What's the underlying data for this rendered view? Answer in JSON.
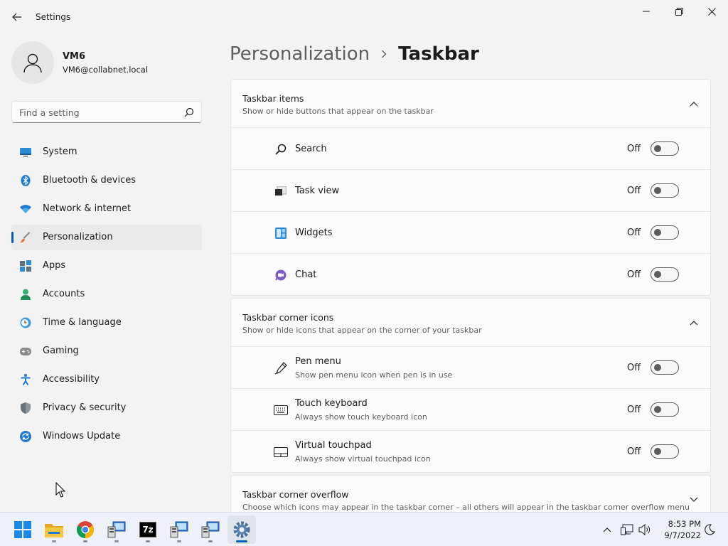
{
  "window": {
    "title": "Settings"
  },
  "user": {
    "name": "VM6",
    "email": "VM6@collabnet.local"
  },
  "search": {
    "placeholder": "Find a setting"
  },
  "nav": [
    {
      "label": "System",
      "icon": "monitor-icon"
    },
    {
      "label": "Bluetooth & devices",
      "icon": "bluetooth-icon"
    },
    {
      "label": "Network & internet",
      "icon": "wifi-icon"
    },
    {
      "label": "Personalization",
      "icon": "brush-icon",
      "active": true
    },
    {
      "label": "Apps",
      "icon": "apps-icon"
    },
    {
      "label": "Accounts",
      "icon": "person-icon"
    },
    {
      "label": "Time & language",
      "icon": "globe-clock-icon"
    },
    {
      "label": "Gaming",
      "icon": "gamepad-icon"
    },
    {
      "label": "Accessibility",
      "icon": "accessibility-icon"
    },
    {
      "label": "Privacy & security",
      "icon": "shield-icon"
    },
    {
      "label": "Windows Update",
      "icon": "update-icon"
    }
  ],
  "breadcrumb": {
    "parent": "Personalization",
    "current": "Taskbar"
  },
  "groups": {
    "taskbar_items": {
      "title": "Taskbar items",
      "description": "Show or hide buttons that appear on the taskbar",
      "rows": [
        {
          "label": "Search",
          "state": "Off",
          "icon": "search-icon"
        },
        {
          "label": "Task view",
          "state": "Off",
          "icon": "task-view-icon"
        },
        {
          "label": "Widgets",
          "state": "Off",
          "icon": "widgets-icon"
        },
        {
          "label": "Chat",
          "state": "Off",
          "icon": "chat-icon"
        }
      ]
    },
    "corner_icons": {
      "title": "Taskbar corner icons",
      "description": "Show or hide icons that appear on the corner of your taskbar",
      "rows": [
        {
          "label": "Pen menu",
          "sub": "Show pen menu icon when pen is in use",
          "state": "Off",
          "icon": "pen-icon"
        },
        {
          "label": "Touch keyboard",
          "sub": "Always show touch keyboard icon",
          "state": "Off",
          "icon": "keyboard-icon"
        },
        {
          "label": "Virtual touchpad",
          "sub": "Always show virtual touchpad icon",
          "state": "Off",
          "icon": "touchpad-icon"
        }
      ]
    },
    "corner_overflow": {
      "title": "Taskbar corner overflow",
      "description": "Choose which icons may appear in the taskbar corner – all others will appear in the taskbar corner overflow menu"
    }
  },
  "taskbar": {
    "apps": [
      "start-icon",
      "file-explorer-icon",
      "chrome-icon",
      "remote-app-icon",
      "7zip-icon",
      "remote-app-icon",
      "remote-app-icon",
      "settings-icon"
    ],
    "seven_zip_label": "7z",
    "clock": {
      "time": "8:53 PM",
      "date": "9/7/2022"
    }
  },
  "colors": {
    "accent": "#005fb8",
    "background": "#f3f3f3",
    "card": "#fbfbfb"
  }
}
